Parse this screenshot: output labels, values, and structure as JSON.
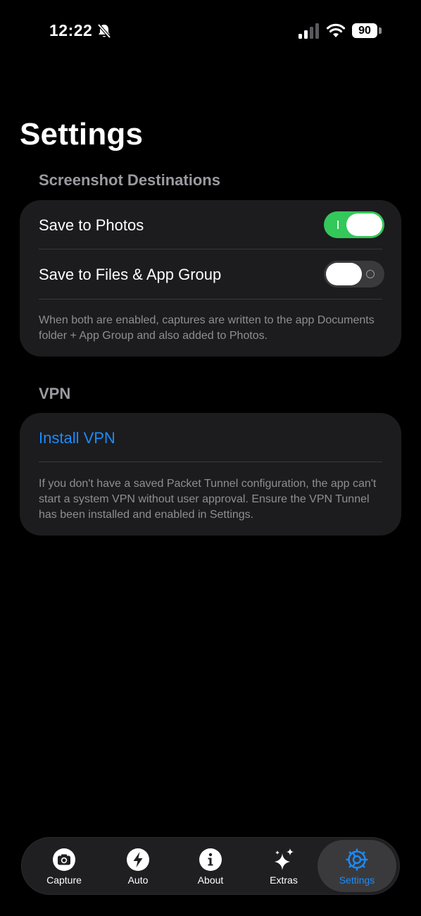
{
  "status": {
    "time": "12:22",
    "battery": "90"
  },
  "page": {
    "title": "Settings"
  },
  "screenshot_section": {
    "header": "Screenshot Destinations",
    "save_photos_label": "Save to Photos",
    "save_photos_on": true,
    "save_files_label": "Save to Files & App Group",
    "save_files_on": false,
    "note": "When both are enabled, captures are written to the app Documents folder + App Group and also added to Photos."
  },
  "vpn_section": {
    "header": "VPN",
    "install_label": "Install VPN",
    "note": "If you don't have a saved Packet Tunnel configuration, the app can't start a system VPN without user approval. Ensure the VPN Tunnel has been installed and enabled in Settings."
  },
  "colors": {
    "accent": "#1a8cff",
    "toggle_on": "#34c759",
    "card_bg": "#1c1c1e"
  },
  "tabs": [
    {
      "label": "Capture",
      "icon": "camera-icon"
    },
    {
      "label": "Auto",
      "icon": "bolt-icon"
    },
    {
      "label": "About",
      "icon": "info-icon"
    },
    {
      "label": "Extras",
      "icon": "sparkles-icon"
    },
    {
      "label": "Settings",
      "icon": "gear-icon",
      "active": true
    }
  ]
}
